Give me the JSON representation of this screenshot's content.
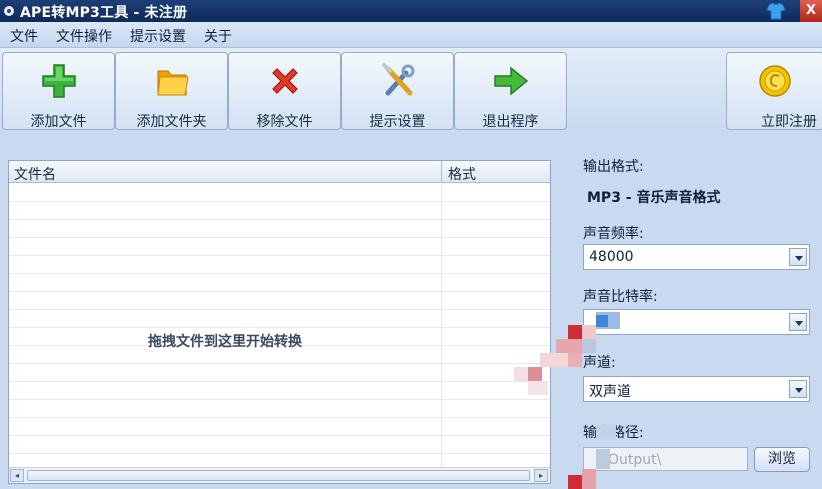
{
  "window": {
    "title": "APE转MP3工具 - 未注册",
    "close_glyph": "X"
  },
  "menu": [
    "文件",
    "文件操作",
    "提示设置",
    "关于"
  ],
  "toolbar": {
    "buttons": [
      {
        "label": "添加文件",
        "icon": "green-plus-icon"
      },
      {
        "label": "添加文件夹",
        "icon": "folder-icon"
      },
      {
        "label": "移除文件",
        "icon": "red-x-icon"
      },
      {
        "label": "提示设置",
        "icon": "tools-icon"
      },
      {
        "label": "退出程序",
        "icon": "green-arrow-icon"
      }
    ],
    "register": {
      "label": "立即注册",
      "icon": "gold-coin-icon"
    }
  },
  "filelist": {
    "columns": [
      "文件名",
      "格式"
    ],
    "drop_hint": "拖拽文件到这里开始转换"
  },
  "settings": {
    "output_format_label": "输出格式:",
    "output_format_value": "MP3 - 音乐声音格式",
    "sample_rate_label": "声音频率:",
    "sample_rate_value": "48000",
    "bitrate_label": "声音比特率:",
    "bitrate_value": "",
    "channel_label": "声道:",
    "channel_value": "双声道",
    "output_path_label": "输出路径:",
    "output_path_value": "Output\\",
    "browse_label": "浏览"
  },
  "colors": {
    "titlebar": "#1d3f78",
    "background": "#c9d9ef",
    "accent_border": "#8aa6cc"
  }
}
